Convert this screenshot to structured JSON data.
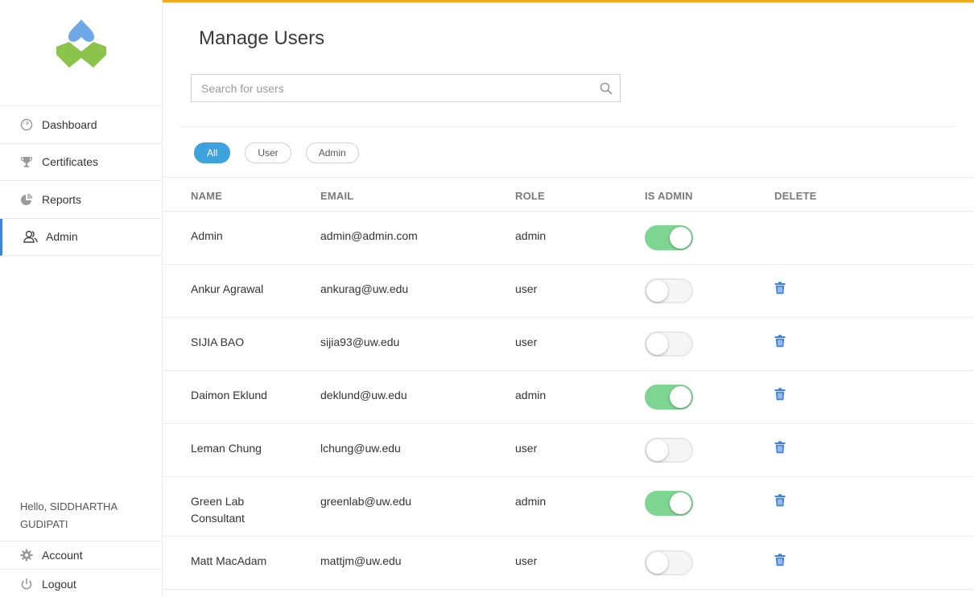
{
  "colors": {
    "accent": "#3f83d9",
    "topbar": "#f5a91b",
    "toggle_on": "#7ed491",
    "pill_active": "#3ea2dc",
    "trash": "#3f83d9"
  },
  "sidebar": {
    "logo": "logo-icon",
    "items": [
      {
        "label": "Dashboard",
        "icon": "gauge-icon"
      },
      {
        "label": "Certificates",
        "icon": "trophy-icon"
      },
      {
        "label": "Reports",
        "icon": "pie-chart-icon"
      },
      {
        "label": "Admin",
        "icon": "users-icon",
        "active": true
      }
    ],
    "greeting": "Hello, SIDDHARTHA GUDIPATI",
    "bottom_items": [
      {
        "label": "Account",
        "icon": "gear-icon"
      },
      {
        "label": "Logout",
        "icon": "power-icon"
      }
    ]
  },
  "main": {
    "title": "Manage Users",
    "search": {
      "placeholder": "Search for users",
      "value": ""
    },
    "filters": [
      "All",
      "User",
      "Admin"
    ],
    "active_filter": "All",
    "columns": [
      "NAME",
      "EMAIL",
      "ROLE",
      "IS ADMIN",
      "DELETE"
    ],
    "users": [
      {
        "name": "Admin",
        "email": "admin@admin.com",
        "role": "admin",
        "is_admin": true,
        "deletable": false
      },
      {
        "name": "Ankur Agrawal",
        "email": "ankurag@uw.edu",
        "role": "user",
        "is_admin": false,
        "deletable": true
      },
      {
        "name": "SIJIA BAO",
        "email": "sijia93@uw.edu",
        "role": "user",
        "is_admin": false,
        "deletable": true
      },
      {
        "name": "Daimon Eklund",
        "email": "deklund@uw.edu",
        "role": "admin",
        "is_admin": true,
        "deletable": true
      },
      {
        "name": "Leman Chung",
        "email": "lchung@uw.edu",
        "role": "user",
        "is_admin": false,
        "deletable": true
      },
      {
        "name": "Green Lab Consultant",
        "email": "greenlab@uw.edu",
        "role": "admin",
        "is_admin": true,
        "deletable": true
      },
      {
        "name": "Matt MacAdam",
        "email": "mattjm@uw.edu",
        "role": "user",
        "is_admin": false,
        "deletable": true
      }
    ]
  }
}
